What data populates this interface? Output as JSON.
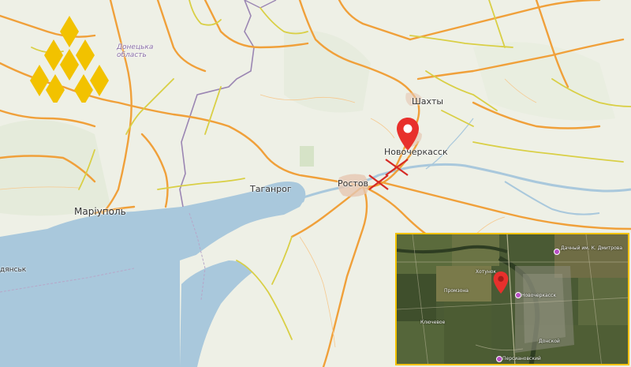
{
  "map": {
    "labels": {
      "mariupol": "Маріуполь",
      "taganrog": "Таганрог",
      "novocherkassk": "Новочеркасск",
      "shakhty": "Шахты",
      "rostov": "Ростов",
      "donetsk_oblast": "Донецька\nобласть",
      "berdiansk_fragment": "дянськ"
    },
    "colors": {
      "land": "#eef0e6",
      "water": "#a9c8dc",
      "major_road": "#f0a03a",
      "secondary_road": "#d9cf45",
      "border": "#9b86b3",
      "marker": "#e8302c",
      "strike_mark": "#d62a24",
      "inset_border": "#f2c200"
    },
    "logo": "yellow-chevron-logo",
    "icons": [
      "location-pin-icon",
      "strike-cross-icon"
    ]
  },
  "inset": {
    "type": "satellite-view",
    "labels": {
      "poi_1": "Дачный им. К. Дмитрова",
      "poi_2": "Новочеркасск",
      "poi_3": "Промзона",
      "poi_4": "Хотунок",
      "poi_5": "Ключевое",
      "poi_6": "Донской",
      "poi_7": "Персиановский"
    }
  }
}
